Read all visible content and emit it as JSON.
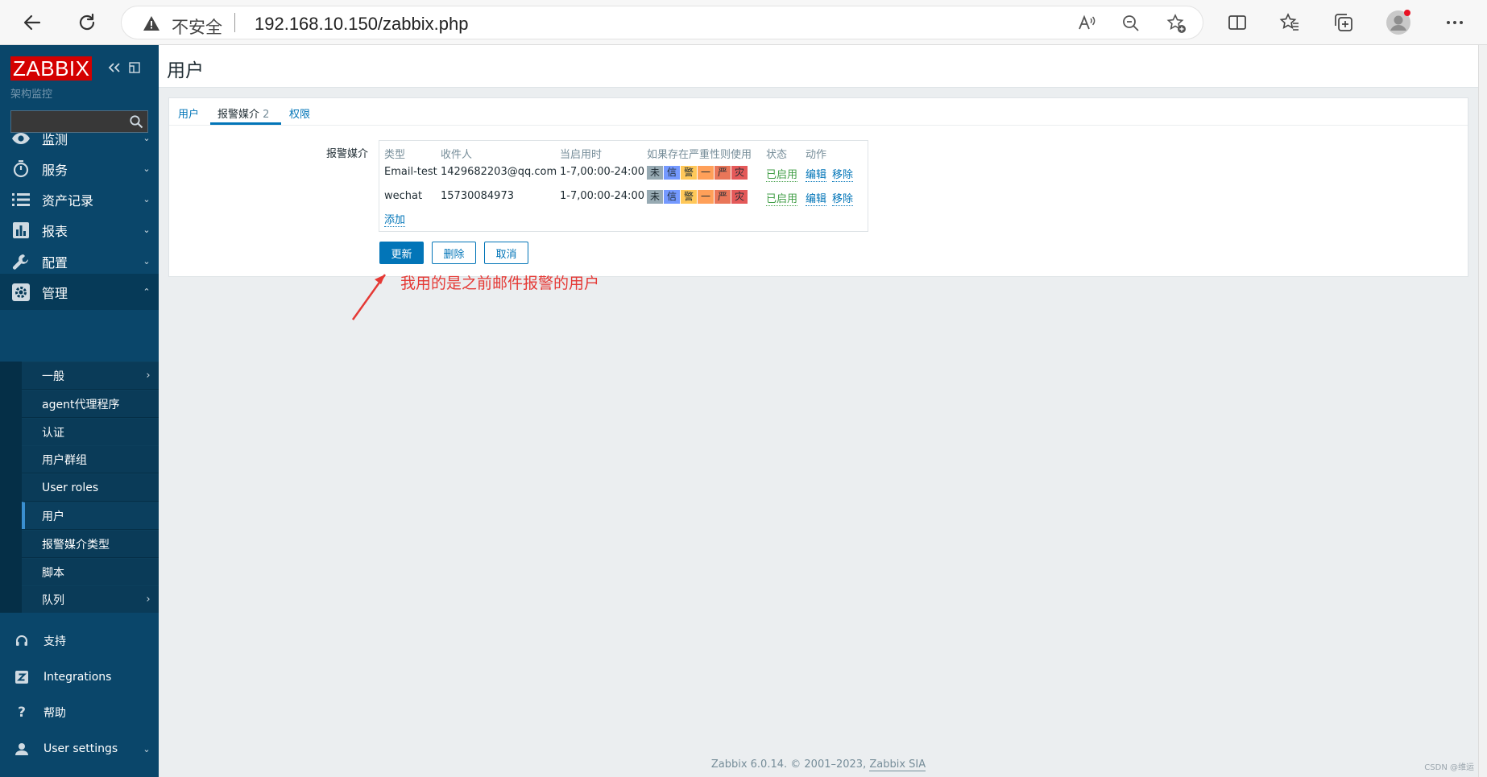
{
  "browser": {
    "insecure_label": "不安全",
    "url": "192.168.10.150/zabbix.php"
  },
  "sidebar": {
    "logo": "ZABBIX",
    "subtitle": "架构监控",
    "search_placeholder": "",
    "menu": [
      {
        "label": "监测",
        "icon": "eye-icon"
      },
      {
        "label": "服务",
        "icon": "timer-icon"
      },
      {
        "label": "资产记录",
        "icon": "list-icon"
      },
      {
        "label": "报表",
        "icon": "bar-chart-icon"
      },
      {
        "label": "配置",
        "icon": "wrench-icon"
      },
      {
        "label": "管理",
        "icon": "gear-icon"
      }
    ],
    "admin_submenu": [
      {
        "label": "一般",
        "has_children": true
      },
      {
        "label": "agent代理程序",
        "has_children": false
      },
      {
        "label": "认证",
        "has_children": false
      },
      {
        "label": "用户群组",
        "has_children": false
      },
      {
        "label": "User roles",
        "has_children": false
      },
      {
        "label": "用户",
        "has_children": false,
        "active": true
      },
      {
        "label": "报警媒介类型",
        "has_children": false
      },
      {
        "label": "脚本",
        "has_children": false
      },
      {
        "label": "队列",
        "has_children": true
      }
    ],
    "bottom": [
      {
        "label": "支持",
        "icon": "headset-icon"
      },
      {
        "label": "Integrations",
        "icon": "integrations-icon"
      },
      {
        "label": "帮助",
        "icon": "help-icon"
      },
      {
        "label": "User settings",
        "icon": "user-icon"
      }
    ]
  },
  "page": {
    "title": "用户"
  },
  "tabs": [
    {
      "label": "用户"
    },
    {
      "label": "报警媒介",
      "count": "2"
    },
    {
      "label": "权限"
    }
  ],
  "media": {
    "form_label": "报警媒介",
    "columns": [
      "类型",
      "收件人",
      "当启用时",
      "如果存在严重性则使用",
      "状态",
      "动作"
    ],
    "rows": [
      {
        "type": "Email-test",
        "recipient": "1429682203@qq.com",
        "when_active": "1-7,00:00-24:00",
        "status": "已启用",
        "edit": "编辑",
        "remove": "移除"
      },
      {
        "type": "wechat",
        "recipient": "15730084973",
        "when_active": "1-7,00:00-24:00",
        "status": "已启用",
        "edit": "编辑",
        "remove": "移除"
      }
    ],
    "severities": [
      {
        "label": "未",
        "color": "#97aab3"
      },
      {
        "label": "信",
        "color": "#7499ff"
      },
      {
        "label": "警",
        "color": "#ffc859"
      },
      {
        "label": "一",
        "color": "#ffa059"
      },
      {
        "label": "严",
        "color": "#e97659"
      },
      {
        "label": "灾",
        "color": "#e45959"
      }
    ],
    "add_link": "添加"
  },
  "buttons": {
    "update": "更新",
    "delete": "删除",
    "cancel": "取消"
  },
  "annotation": "我用的是之前邮件报警的用户",
  "footer": {
    "text": "Zabbix 6.0.14. © 2001–2023, ",
    "link": "Zabbix SIA"
  },
  "watermark": "CSDN @维运"
}
